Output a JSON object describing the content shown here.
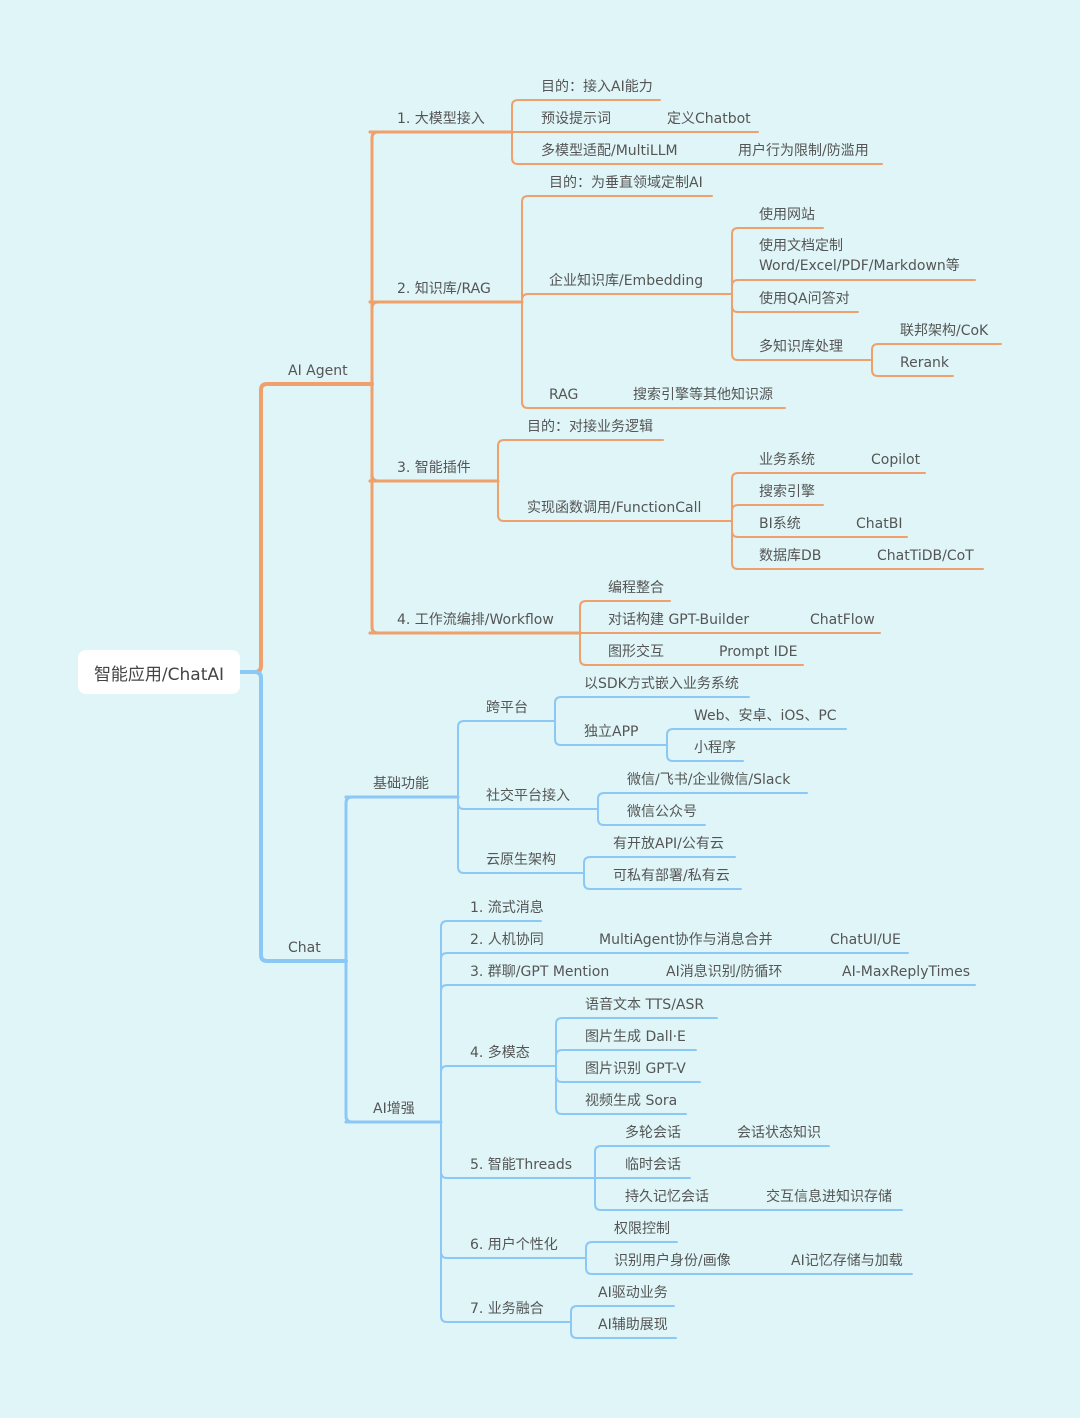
{
  "title": "智能应用/ChatAI",
  "colors": {
    "background": "#dff5f8",
    "agent_branch": "#f0a06a",
    "chat_branch": "#8cc8f5",
    "text": "#555555"
  },
  "root": {
    "label": "智能应用/ChatAI",
    "children": [
      {
        "label": "AI Agent",
        "branch": "agent",
        "children": [
          {
            "label": "1. 大模型接入",
            "children": [
              {
                "label": "目的：接入AI能力"
              },
              {
                "label": "预设提示词",
                "children": [
                  {
                    "label": "定义Chatbot"
                  }
                ]
              },
              {
                "label": "多模型适配/MultiLLM",
                "children": [
                  {
                    "label": "用户行为限制/防滥用"
                  }
                ]
              }
            ]
          },
          {
            "label": "2. 知识库/RAG",
            "children": [
              {
                "label": "目的：为垂直领域定制AI"
              },
              {
                "label": "企业知识库/Embedding",
                "children": [
                  {
                    "label": "使用网站"
                  },
                  {
                    "label": "使用文档定制\nWord/Excel/PDF/Markdown等"
                  },
                  {
                    "label": "使用QA问答对"
                  },
                  {
                    "label": "多知识库处理",
                    "children": [
                      {
                        "label": "联邦架构/CoK"
                      },
                      {
                        "label": "Rerank"
                      }
                    ]
                  }
                ]
              },
              {
                "label": "RAG",
                "children": [
                  {
                    "label": "搜索引擎等其他知识源"
                  }
                ]
              }
            ]
          },
          {
            "label": "3. 智能插件",
            "children": [
              {
                "label": "目的：对接业务逻辑"
              },
              {
                "label": "实现函数调用/FunctionCall",
                "children": [
                  {
                    "label": "业务系统",
                    "children": [
                      {
                        "label": "Copilot"
                      }
                    ]
                  },
                  {
                    "label": "搜索引擎"
                  },
                  {
                    "label": "BI系统",
                    "children": [
                      {
                        "label": "ChatBI"
                      }
                    ]
                  },
                  {
                    "label": "数据库DB",
                    "children": [
                      {
                        "label": "ChatTiDB/CoT"
                      }
                    ]
                  }
                ]
              }
            ]
          },
          {
            "label": "4. 工作流编排/Workflow",
            "children": [
              {
                "label": "编程整合"
              },
              {
                "label": "对话构建 GPT-Builder",
                "children": [
                  {
                    "label": "ChatFlow"
                  }
                ]
              },
              {
                "label": "图形交互",
                "children": [
                  {
                    "label": "Prompt IDE"
                  }
                ]
              }
            ]
          }
        ]
      },
      {
        "label": "Chat",
        "branch": "chat",
        "children": [
          {
            "label": "基础功能",
            "children": [
              {
                "label": "跨平台",
                "children": [
                  {
                    "label": "以SDK方式嵌入业务系统"
                  },
                  {
                    "label": "独立APP",
                    "children": [
                      {
                        "label": "Web、安卓、iOS、PC"
                      },
                      {
                        "label": "小程序"
                      }
                    ]
                  }
                ]
              },
              {
                "label": "社交平台接入",
                "children": [
                  {
                    "label": "微信/飞书/企业微信/Slack"
                  },
                  {
                    "label": "微信公众号"
                  }
                ]
              },
              {
                "label": "云原生架构",
                "children": [
                  {
                    "label": "有开放API/公有云"
                  },
                  {
                    "label": "可私有部署/私有云"
                  }
                ]
              }
            ]
          },
          {
            "label": "AI增强",
            "children": [
              {
                "label": "1. 流式消息"
              },
              {
                "label": "2. 人机协同",
                "children": [
                  {
                    "label": "MultiAgent协作与消息合并",
                    "children": [
                      {
                        "label": "ChatUI/UE"
                      }
                    ]
                  }
                ]
              },
              {
                "label": "3. 群聊/GPT Mention",
                "children": [
                  {
                    "label": "AI消息识别/防循环",
                    "children": [
                      {
                        "label": "AI-MaxReplyTimes"
                      }
                    ]
                  }
                ]
              },
              {
                "label": "4. 多模态",
                "children": [
                  {
                    "label": "语音文本 TTS/ASR"
                  },
                  {
                    "label": "图片生成 Dall·E"
                  },
                  {
                    "label": "图片识别 GPT-V"
                  },
                  {
                    "label": "视频生成 Sora"
                  }
                ]
              },
              {
                "label": "5. 智能Threads",
                "children": [
                  {
                    "label": "多轮会话",
                    "children": [
                      {
                        "label": "会话状态知识"
                      }
                    ]
                  },
                  {
                    "label": "临时会话"
                  },
                  {
                    "label": "持久记忆会话",
                    "children": [
                      {
                        "label": "交互信息进知识存储"
                      }
                    ]
                  }
                ]
              },
              {
                "label": "6. 用户个性化",
                "children": [
                  {
                    "label": "权限控制"
                  },
                  {
                    "label": "识别用户身份/画像",
                    "children": [
                      {
                        "label": "AI记忆存储与加载"
                      }
                    ]
                  }
                ]
              },
              {
                "label": "7. 业务融合",
                "children": [
                  {
                    "label": "AI驱动业务"
                  },
                  {
                    "label": "AI辅助展现"
                  }
                ]
              }
            ]
          }
        ]
      }
    ]
  }
}
